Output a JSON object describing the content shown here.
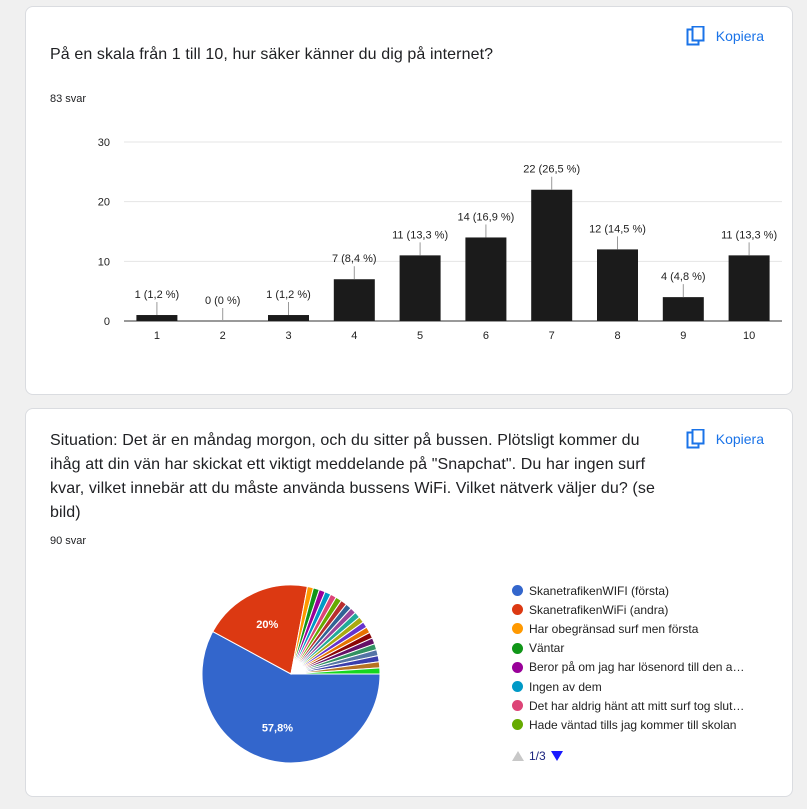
{
  "questions": [
    {
      "title": "På en skala från 1 till 10, hur säker känner du dig på internet?",
      "count": "83 svar",
      "copy_label": "Kopiera"
    },
    {
      "title": "Situation: Det är en måndag morgon, och du sitter på bussen. Plötsligt kommer du ihåg att din vän har skickat ett viktigt meddelande på \"Snapchat\". Du har ingen surf kvar, vilket innebär att du måste använda bussens WiFi. Vilket nätverk väljer du? (se bild)",
      "count": "90 svar",
      "copy_label": "Kopiera"
    }
  ],
  "chart_data": [
    {
      "type": "bar",
      "categories": [
        "1",
        "2",
        "3",
        "4",
        "5",
        "6",
        "7",
        "8",
        "9",
        "10"
      ],
      "values": [
        1,
        0,
        1,
        7,
        11,
        14,
        22,
        12,
        4,
        11
      ],
      "data_labels": [
        "1 (1,2 %)",
        "0 (0 %)",
        "1 (1,2 %)",
        "7 (8,4 %)",
        "11 (13,3 %)",
        "14 (16,9 %)",
        "22 (26,5 %)",
        "12 (14,5 %)",
        "4 (4,8 %)",
        "11 (13,3 %)"
      ],
      "yticks": [
        0,
        10,
        20,
        30
      ],
      "ylim": [
        0,
        30
      ],
      "grid": true,
      "bar_color": "#1b1b1b"
    },
    {
      "type": "pie",
      "slices": [
        {
          "label": "SkanetrafikenWIFI (första)",
          "value": 57.8,
          "color": "#3366cc",
          "text": "57,8%"
        },
        {
          "label": "SkanetrafikenWiFi (andra)",
          "value": 20,
          "color": "#dc3912",
          "text": "20%"
        },
        {
          "label": "Har obegränsad surf men första",
          "value": 1.1,
          "color": "#ff9900",
          "text": ""
        },
        {
          "label": "Väntar",
          "value": 1.1,
          "color": "#109618",
          "text": ""
        },
        {
          "label": "Beror på om jag har lösenord till den a…",
          "value": 1.1,
          "color": "#990099",
          "text": ""
        },
        {
          "label": "Ingen av dem",
          "value": 1.1,
          "color": "#0099c6",
          "text": ""
        },
        {
          "label": "Det har aldrig hänt att mitt surf tog slut…",
          "value": 1.1,
          "color": "#dd4477",
          "text": ""
        },
        {
          "label": "Hade väntad tills jag kommer till skolan",
          "value": 1.1,
          "color": "#66aa00",
          "text": ""
        },
        {
          "label": "",
          "value": 1.1,
          "color": "#b82e2e",
          "text": ""
        },
        {
          "label": "",
          "value": 1.1,
          "color": "#316395",
          "text": ""
        },
        {
          "label": "",
          "value": 1.1,
          "color": "#994499",
          "text": ""
        },
        {
          "label": "",
          "value": 1.1,
          "color": "#22aa99",
          "text": ""
        },
        {
          "label": "",
          "value": 1.1,
          "color": "#aaaa11",
          "text": ""
        },
        {
          "label": "",
          "value": 1.1,
          "color": "#6633cc",
          "text": ""
        },
        {
          "label": "",
          "value": 1.1,
          "color": "#e67300",
          "text": ""
        },
        {
          "label": "",
          "value": 1.1,
          "color": "#8b0707",
          "text": ""
        },
        {
          "label": "",
          "value": 1.1,
          "color": "#651067",
          "text": ""
        },
        {
          "label": "",
          "value": 1.1,
          "color": "#329262",
          "text": ""
        },
        {
          "label": "",
          "value": 1.1,
          "color": "#5574a6",
          "text": ""
        },
        {
          "label": "",
          "value": 1.1,
          "color": "#3b3eac",
          "text": ""
        },
        {
          "label": "",
          "value": 1.1,
          "color": "#b77322",
          "text": ""
        },
        {
          "label": "",
          "value": 1.1,
          "color": "#16d620",
          "text": ""
        }
      ],
      "legend_visible_count": 8,
      "legend_placement": "right",
      "pager": "1/3"
    }
  ]
}
